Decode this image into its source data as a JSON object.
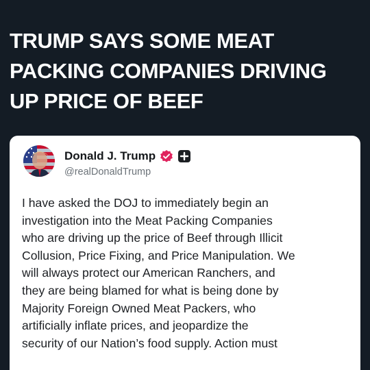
{
  "headline": {
    "lines": [
      "TRUMP SAYS SOME MEAT",
      "PACKING COMPANIES DRIVING",
      "UP PRICE OF BEEF"
    ]
  },
  "post": {
    "author_name": "Donald J. Trump",
    "handle": "@realDonaldTrump",
    "avatar_icon": "flag-portrait-avatar",
    "verified_icon": "verified-badge-icon",
    "verified_color": "#e0245e",
    "extra_badge_icon": "plus-badge-icon",
    "body_lines": [
      "I have asked the DOJ to immediately begin an",
      "investigation into the Meat Packing Companies",
      "who are driving up the price of Beef through Illicit",
      "Collusion, Price Fixing, and Price Manipulation. We",
      "will always protect our American Ranchers, and",
      "they are being blamed for what is being done by",
      "Majority Foreign Owned Meat Packers, who",
      "artificially inflate prices, and jeopardize the",
      "security of our Nation’s food supply. Action must"
    ]
  },
  "colors": {
    "background": "#141c25",
    "headline_text": "#ffffff",
    "card": "#ffffff",
    "handle_text": "#6b7278"
  }
}
